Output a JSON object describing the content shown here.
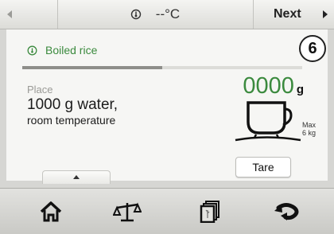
{
  "topbar": {
    "temperature": "--°C",
    "next_label": "Next",
    "icons": [
      "chevron-left-icon",
      "thermometer-icon",
      "chevron-right-icon"
    ]
  },
  "step": {
    "number": "6"
  },
  "recipe": {
    "name": "Boiled rice",
    "icon": "recipe-icon"
  },
  "progress": {
    "fraction": 0.5
  },
  "instruction": {
    "label": "Place",
    "line1": "1000 g water,",
    "line2": "room temperature"
  },
  "scale": {
    "value": "0000",
    "unit": "g",
    "max_line1": "Max",
    "max_line2": "6 kg",
    "tare_label": "Tare"
  },
  "nav": {
    "items": [
      "home-icon",
      "scale-icon",
      "recipes-icon",
      "back-icon"
    ]
  },
  "colors": {
    "accent": "#3b8a3e",
    "background": "#f6f6f4"
  }
}
